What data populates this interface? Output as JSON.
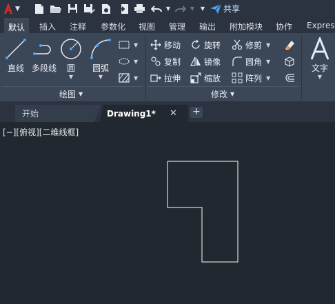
{
  "quick_access": {
    "share_label": "共享"
  },
  "ribbon_tabs": [
    "默认",
    "插入",
    "注释",
    "参数化",
    "视图",
    "管理",
    "输出",
    "附加模块",
    "协作",
    "Express"
  ],
  "draw_panel": {
    "title": "绘图",
    "tools": {
      "line": "直线",
      "polyline": "多段线",
      "circle": "圆",
      "arc": "圆弧"
    }
  },
  "modify_panel": {
    "title": "修改",
    "tools": {
      "move": "移动",
      "rotate": "旋转",
      "trim": "修剪",
      "copy": "复制",
      "mirror": "镜像",
      "fillet": "圆角",
      "stretch": "拉伸",
      "scale": "缩放",
      "array": "阵列"
    }
  },
  "annotation_panel": {
    "text": "文字"
  },
  "doc_tabs": {
    "start": "开始",
    "active": "Drawing1*",
    "close": "✕",
    "new": "+"
  },
  "viewport": {
    "label": "[−][俯视][二维线框]"
  },
  "colors": {
    "background": "#212830",
    "ribbon": "#3b4657",
    "accent": "#d42f2f",
    "share": "#4da3ff",
    "geometry": "#ffffff"
  }
}
